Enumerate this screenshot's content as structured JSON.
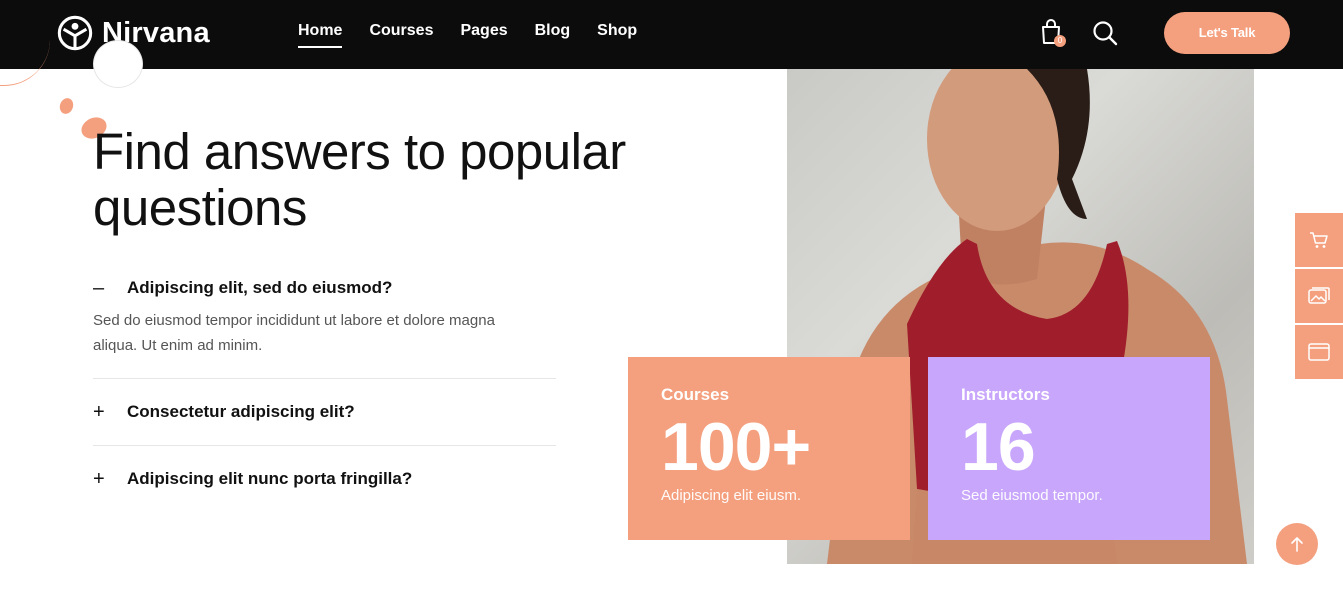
{
  "header": {
    "brand": "Nirvana",
    "nav": [
      {
        "label": "Home",
        "active": true
      },
      {
        "label": "Courses",
        "active": false
      },
      {
        "label": "Pages",
        "active": false
      },
      {
        "label": "Blog",
        "active": false
      },
      {
        "label": "Shop",
        "active": false
      }
    ],
    "cart_count": "0",
    "cta_label": "Let's Talk",
    "icons": {
      "cart": "shopping-bag-icon",
      "search": "search-icon"
    }
  },
  "main": {
    "title": "Find answers to popular questions",
    "faq": [
      {
        "toggle": "–",
        "question": "Adipiscing elit, sed do eiusmod?",
        "answer": "Sed do eiusmod tempor incididunt ut labore et dolore magna aliqua. Ut enim ad minim.",
        "open": true
      },
      {
        "toggle": "+",
        "question": "Consectetur adipiscing elit?",
        "open": false
      },
      {
        "toggle": "+",
        "question": "Adipiscing elit nunc porta fringilla?",
        "open": false
      }
    ]
  },
  "stats": [
    {
      "label": "Courses",
      "value": "100+",
      "desc": "Adipiscing elit eiusm."
    },
    {
      "label": "Instructors",
      "value": "16",
      "desc": "Sed eiusmod tempor."
    }
  ],
  "side_tools": [
    "cart-icon",
    "image-gallery-icon",
    "browser-window-icon"
  ],
  "colors": {
    "accent": "#f4a07f",
    "lavender": "#c8a6fb",
    "header_bg": "#0c0c0c"
  }
}
